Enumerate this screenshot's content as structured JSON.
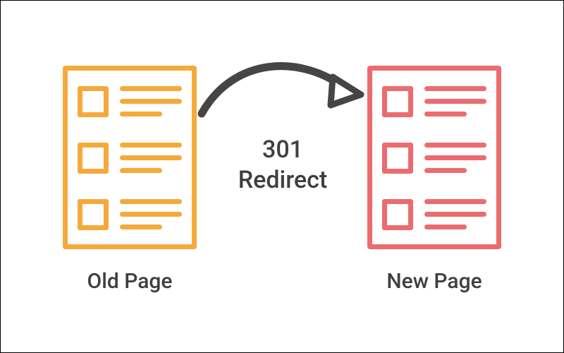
{
  "diagram": {
    "left_label": "Old Page",
    "right_label": "New Page",
    "center_line1": "301",
    "center_line2": "Redirect"
  },
  "colors": {
    "left": "#f6a93b",
    "right": "#ec6b6f",
    "text": "#3f3f3f",
    "arrow": "#454545"
  }
}
